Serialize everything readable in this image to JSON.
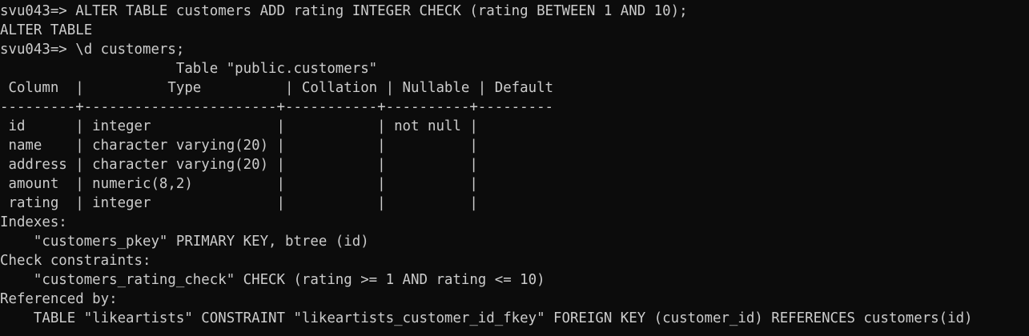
{
  "terminal": {
    "colors": {
      "background": "#0c0c0c",
      "text": "#cccccc"
    },
    "lines": [
      "svu043=> ALTER TABLE customers ADD rating INTEGER CHECK (rating BETWEEN 1 AND 10);",
      "ALTER TABLE",
      "svu043=> \\d customers;",
      "                     Table \"public.customers\"",
      " Column  |          Type          | Collation | Nullable | Default",
      "---------+-----------------------+-----------+----------+---------",
      " id      | integer               |           | not null |",
      " name    | character varying(20) |           |          |",
      " address | character varying(20) |           |          |",
      " amount  | numeric(8,2)          |           |          |",
      " rating  | integer               |           |          |",
      "Indexes:",
      "    \"customers_pkey\" PRIMARY KEY, btree (id)",
      "Check constraints:",
      "    \"customers_rating_check\" CHECK (rating >= 1 AND rating <= 10)",
      "Referenced by:",
      "    TABLE \"likeartists\" CONSTRAINT \"likeartists_customer_id_fkey\" FOREIGN KEY (customer_id) REFERENCES customers(id)"
    ]
  }
}
